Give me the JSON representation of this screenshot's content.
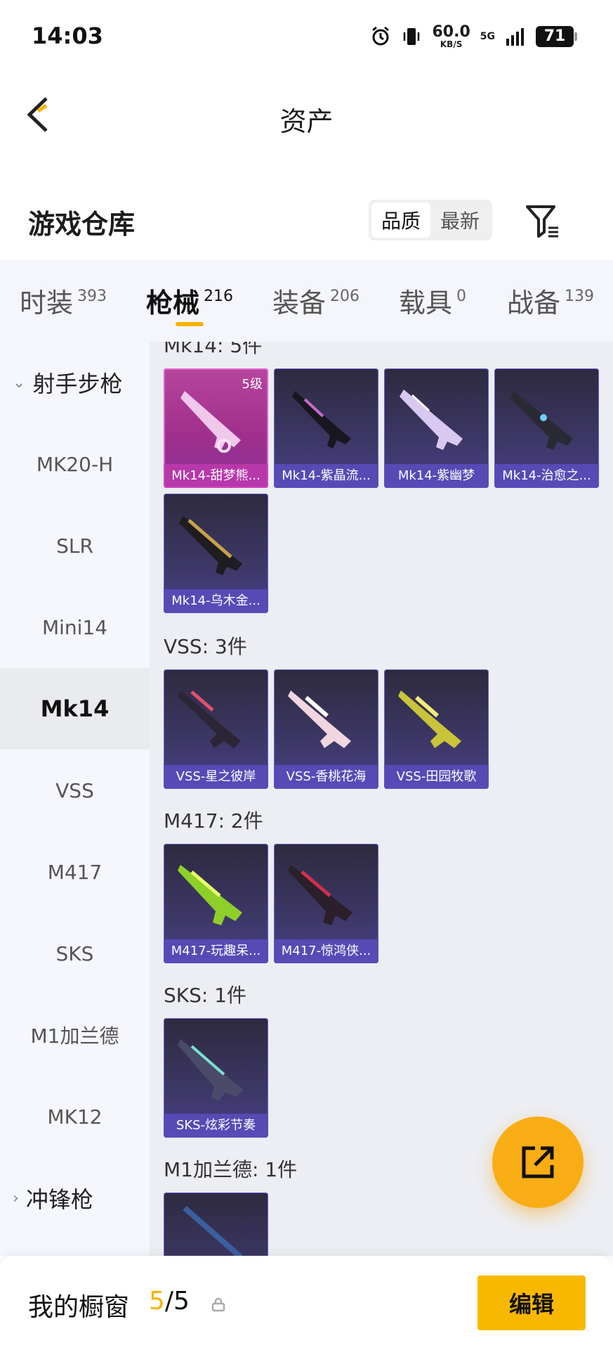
{
  "status_bar": {
    "time": "14:03",
    "speed_value": "60.0",
    "speed_unit": "KB/S",
    "network": "5G",
    "battery": "71"
  },
  "header": {
    "title": "资产",
    "back_icon": "chevron-left-icon"
  },
  "warehouse": {
    "title": "游戏仓库",
    "sort_options": [
      "品质",
      "最新"
    ],
    "active_sort": "品质",
    "filter_icon": "filter-icon"
  },
  "tabs": [
    {
      "label": "时装",
      "count": "393"
    },
    {
      "label": "枪械",
      "count": "216"
    },
    {
      "label": "装备",
      "count": "206"
    },
    {
      "label": "载具",
      "count": "0"
    },
    {
      "label": "战备",
      "count": "139"
    }
  ],
  "active_tab": "枪械",
  "sidebar": {
    "group_open": "射手步枪",
    "items": [
      "MK20-H",
      "SLR",
      "Mini14",
      "Mk14",
      "VSS",
      "M417",
      "SKS",
      "M1加兰德",
      "MK12"
    ],
    "active_item": "Mk14",
    "group_next": "冲锋枪"
  },
  "sections": [
    {
      "title": "Mk14: 5件",
      "items": [
        {
          "name": "Mk14-甜梦熊...",
          "level": "5级",
          "rarity": "pink"
        },
        {
          "name": "Mk14-紫晶流...",
          "rarity": "purple"
        },
        {
          "name": "Mk14-紫幽梦",
          "rarity": "purple"
        },
        {
          "name": "Mk14-治愈之...",
          "rarity": "purple"
        },
        {
          "name": "Mk14-乌木金...",
          "rarity": "purple"
        }
      ]
    },
    {
      "title": "VSS: 3件",
      "items": [
        {
          "name": "VSS-星之彼岸",
          "rarity": "purple"
        },
        {
          "name": "VSS-香桃花海",
          "rarity": "purple"
        },
        {
          "name": "VSS-田园牧歌",
          "rarity": "purple"
        }
      ]
    },
    {
      "title": "M417: 2件",
      "items": [
        {
          "name": "M417-玩趣呆...",
          "rarity": "purple"
        },
        {
          "name": "M417-惊鸿侠...",
          "rarity": "purple"
        }
      ]
    },
    {
      "title": "SKS: 1件",
      "items": [
        {
          "name": "SKS-炫彩节奏",
          "rarity": "purple"
        }
      ]
    },
    {
      "title": "M1加兰德: 1件",
      "items": []
    }
  ],
  "fab": {
    "icon": "share-external-icon"
  },
  "bottom_bar": {
    "showcase_label": "我的橱窗",
    "current": "5",
    "total": "5",
    "edit_label": "编辑",
    "lock_icon": "lock-icon"
  },
  "colors": {
    "accent": "#f9b800",
    "fab": "#f9ad14",
    "card_purple": "#4a3f8a",
    "card_pink": "#b5459d"
  }
}
